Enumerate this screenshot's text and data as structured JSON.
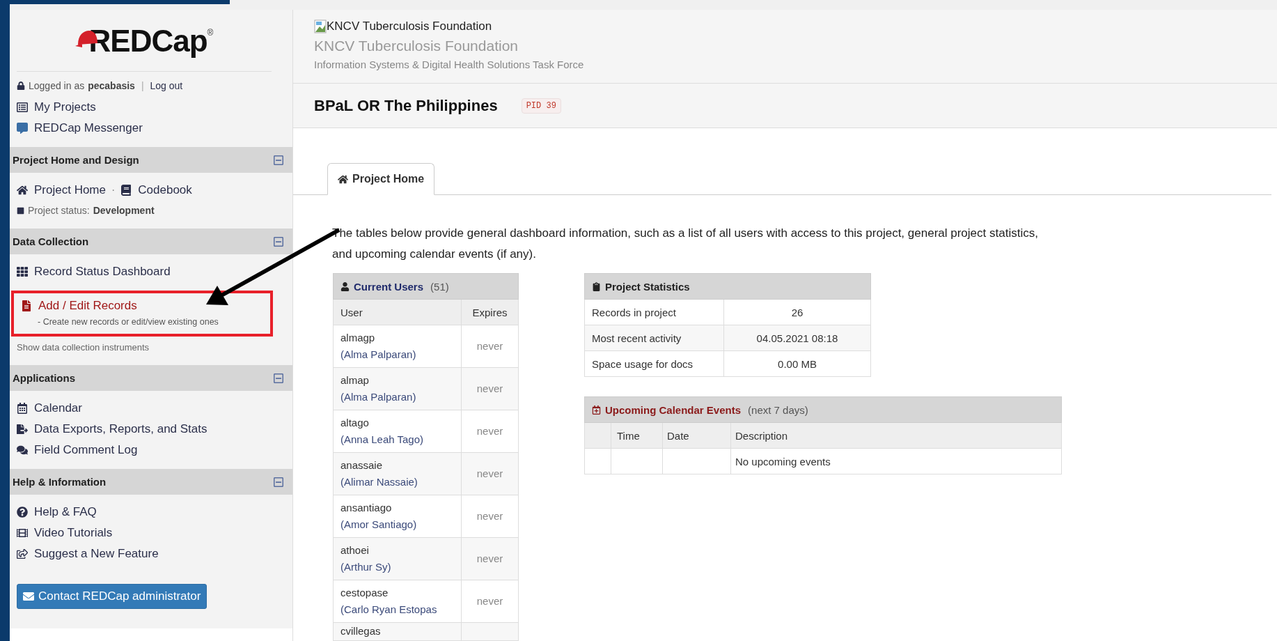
{
  "logo": {
    "text": "REDCap",
    "mark": "®"
  },
  "login": {
    "prefix": "Logged in as",
    "user": "pecabasis",
    "separator": "|",
    "logout": "Log out"
  },
  "top_links": [
    {
      "label": "My Projects"
    },
    {
      "label": "REDCap Messenger"
    }
  ],
  "sections": [
    {
      "title": "Project Home and Design",
      "expanded": true,
      "items": [
        {
          "kind": "link-pair",
          "separator": "·",
          "links": [
            {
              "label": "Project Home"
            },
            {
              "label": "Codebook"
            }
          ]
        },
        {
          "kind": "status",
          "label": "Project status:",
          "value": "Development"
        }
      ]
    },
    {
      "title": "Data Collection",
      "expanded": true,
      "items": [
        {
          "kind": "link",
          "label": "Record Status Dashboard"
        },
        {
          "kind": "highlighted",
          "label": "Add / Edit Records",
          "note": "- Create new records or edit/view existing ones"
        },
        {
          "kind": "note",
          "label": "Show data collection instruments"
        }
      ]
    },
    {
      "title": "Applications",
      "expanded": true,
      "items": [
        {
          "kind": "link",
          "label": "Calendar"
        },
        {
          "kind": "link",
          "label": "Data Exports, Reports, and Stats"
        },
        {
          "kind": "link",
          "label": "Field Comment Log"
        }
      ]
    },
    {
      "title": "Help & Information",
      "expanded": true,
      "items": [
        {
          "kind": "link",
          "label": "Help & FAQ"
        },
        {
          "kind": "link",
          "label": "Video Tutorials"
        },
        {
          "kind": "link",
          "label": "Suggest a New Feature"
        },
        {
          "kind": "button",
          "label": "Contact REDCap administrator"
        }
      ]
    }
  ],
  "header": {
    "image_alt": "KNCV Tuberculosis Foundation",
    "org": "KNCV Tuberculosis Foundation",
    "subtitle": "Information Systems & Digital Health Solutions Task Force"
  },
  "project": {
    "title": "BPaL OR The Philippines",
    "pid": "PID 39"
  },
  "tabs": [
    {
      "label": "Project Home",
      "selected": true
    }
  ],
  "intro": "The tables below provide general dashboard information, such as a list of all users with access to this project, general project statistics, and upcoming calendar events (if any).",
  "users_table": {
    "title": "Current Users",
    "count": "(51)",
    "columns": [
      "User",
      "Expires"
    ],
    "rows": [
      {
        "username": "almagp",
        "fullname": "(Alma Palparan)",
        "expires": "never"
      },
      {
        "username": "almap",
        "fullname": "(Alma Palparan)",
        "expires": "never"
      },
      {
        "username": "altago",
        "fullname": "(Anna Leah Tago)",
        "expires": "never"
      },
      {
        "username": "anassaie",
        "fullname": "(Alimar Nassaie)",
        "expires": "never"
      },
      {
        "username": "ansantiago",
        "fullname": "(Amor Santiago)",
        "expires": "never"
      },
      {
        "username": "athoei",
        "fullname": "(Arthur Sy)",
        "expires": "never"
      },
      {
        "username": "cestopase",
        "fullname": "(Carlo Ryan Estopas",
        "expires": "never"
      },
      {
        "username": "cvillegas"
      }
    ]
  },
  "stats_table": {
    "title": "Project Statistics",
    "rows": [
      {
        "label": "Records in project",
        "value": "26"
      },
      {
        "label": "Most recent activity",
        "value": "04.05.2021 08:18"
      },
      {
        "label": "Space usage for docs",
        "value": "0.00 MB"
      }
    ]
  },
  "events_table": {
    "title": "Upcoming Calendar Events",
    "note": "(next 7 days)",
    "columns": [
      "Time",
      "Date",
      "Description"
    ],
    "rows": [
      {
        "description": "No upcoming events"
      }
    ]
  }
}
